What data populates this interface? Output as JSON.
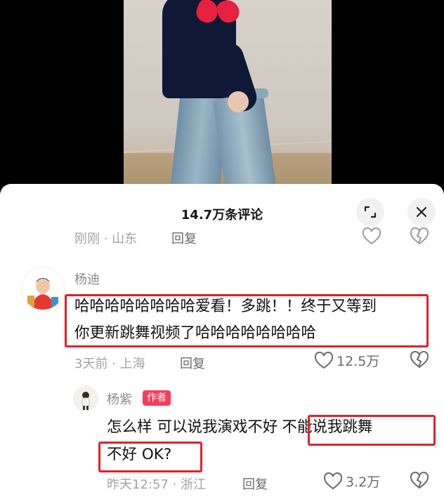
{
  "panel": {
    "title": "14.7万条评论"
  },
  "prev_comment": {
    "meta": "刚刚 · 山东",
    "reply_label": "回复"
  },
  "comment": {
    "username": "杨迪",
    "text_line1": "哈哈哈哈哈哈哈哈爱看！多跳！！终于又等到",
    "text_line2": "你更新跳舞视频了哈哈哈哈哈哈哈哈",
    "meta": "3天前 · 上海",
    "reply_label": "回复",
    "like_count": "12.5万"
  },
  "reply": {
    "username": "杨紫",
    "badge": "作者",
    "text_part1": "怎么样 可以说我演戏不好",
    "text_part2": "不能说我跳舞",
    "text_line2": "不好 OK?",
    "meta": "昨天12:57 · 浙江",
    "reply_label": "回复",
    "like_count": "3.2万"
  },
  "colors": {
    "highlight_box": "#e02128",
    "author_badge": "#f53e5c"
  },
  "icons": [
    "expand-icon",
    "close-icon",
    "heart-icon",
    "broken-heart-icon"
  ]
}
